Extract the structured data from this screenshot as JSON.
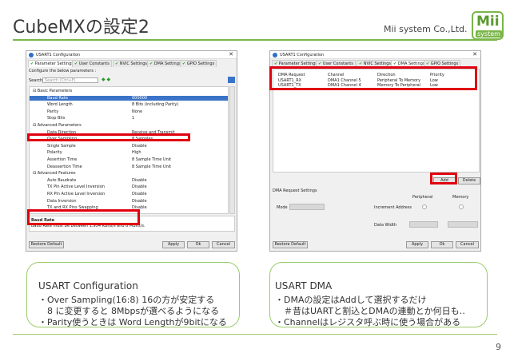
{
  "header": {
    "title": "CubeMXの設定2",
    "company": "Mii system Co.,Ltd.",
    "logo_top": "Mii",
    "logo_bottom": "system"
  },
  "page_number": "9",
  "left_window": {
    "title": "USART1 Configuration",
    "tabs": [
      "Parameter Settings",
      "User Constants",
      "NVIC Settings",
      "DMA Settings",
      "GPIO Settings"
    ],
    "configure_label": "Configure the below parameters :",
    "search_label": "Search:",
    "search_placeholder": "Search (Ctrl+F)",
    "rows": [
      {
        "name": "Basic Parameters",
        "value": ""
      },
      {
        "name": "Baud Rate",
        "value": "000000"
      },
      {
        "name": "Word Length",
        "value": "8 Bits (including Parity)"
      },
      {
        "name": "Parity",
        "value": "None"
      },
      {
        "name": "Stop Bits",
        "value": "1"
      },
      {
        "name": "Advanced Parameters",
        "value": ""
      },
      {
        "name": "Data Direction",
        "value": "Receive and Transmit"
      },
      {
        "name": "Over Sampling",
        "value": "8 Samples"
      },
      {
        "name": "Single Sample",
        "value": "Disable"
      },
      {
        "name": "Polarity",
        "value": "High"
      },
      {
        "name": "Assertion Time",
        "value": "8 Sample Time Unit"
      },
      {
        "name": "Deassertion Time",
        "value": "8 Sample Time Unit"
      },
      {
        "name": "Advanced Features",
        "value": ""
      },
      {
        "name": "Auto Baudrate",
        "value": "Disable"
      },
      {
        "name": "TX Pin Active Level Inversion",
        "value": "Disable"
      },
      {
        "name": "RX Pin Active Level Inversion",
        "value": "Disable"
      },
      {
        "name": "Data Inversion",
        "value": "Disable"
      },
      {
        "name": "TX and RX Pins Swapping",
        "value": "Disable"
      }
    ],
    "desc_title": "Baud Rate",
    "desc_text": "Baud Rate must be between 1.954 KBits/s and 8 MBits/s.",
    "restore_label": "Restore Default",
    "apply_label": "Apply",
    "ok_label": "Ok",
    "cancel_label": "Cancel"
  },
  "right_window": {
    "title": "USART1 Configuration",
    "tabs": [
      "Parameter Settings",
      "User Constants",
      "NVIC Settings",
      "DMA Settings",
      "GPIO Settings"
    ],
    "columns": [
      "DMA Request",
      "Channel",
      "Direction",
      "Priority"
    ],
    "dma_rows": [
      [
        "USART1_RX",
        "DMA1 Channel 5",
        "Peripheral To Memory",
        "Low"
      ],
      [
        "USART1_TX",
        "DMA1 Channel 4",
        "Memory To Peripheral",
        "Low"
      ]
    ],
    "add_label": "Add",
    "delete_label": "Delete",
    "request_settings_label": "DMA Request Settings",
    "peripheral_label": "Peripheral",
    "memory_label": "Memory",
    "mode_label": "Mode",
    "increment_label": "Increment Address",
    "data_width_label": "Data Width",
    "restore_label": "Restore Default",
    "apply_label": "Apply",
    "ok_label": "Ok",
    "cancel_label": "Cancel"
  },
  "cards": [
    {
      "heading": "USART Configuration",
      "lines": [
        "・Over Sampling(16:8) 16の方が安定する",
        "　8 に変更すると 8Mbpsが選べるようになる",
        "・Parity使うときは Word Lengthが9bitになる"
      ]
    },
    {
      "heading": "USART DMA",
      "lines": [
        "・DMAの設定はAddして選択するだけ",
        "　＃昔はUARTと割込とDMAの連動とか何日も‥",
        "・Channelはレジスタ呼ぶ時に使う場合がある"
      ]
    }
  ],
  "colors": {
    "accent": "#7ab648",
    "highlight": "#e0000f",
    "selection": "#3b73c8"
  }
}
